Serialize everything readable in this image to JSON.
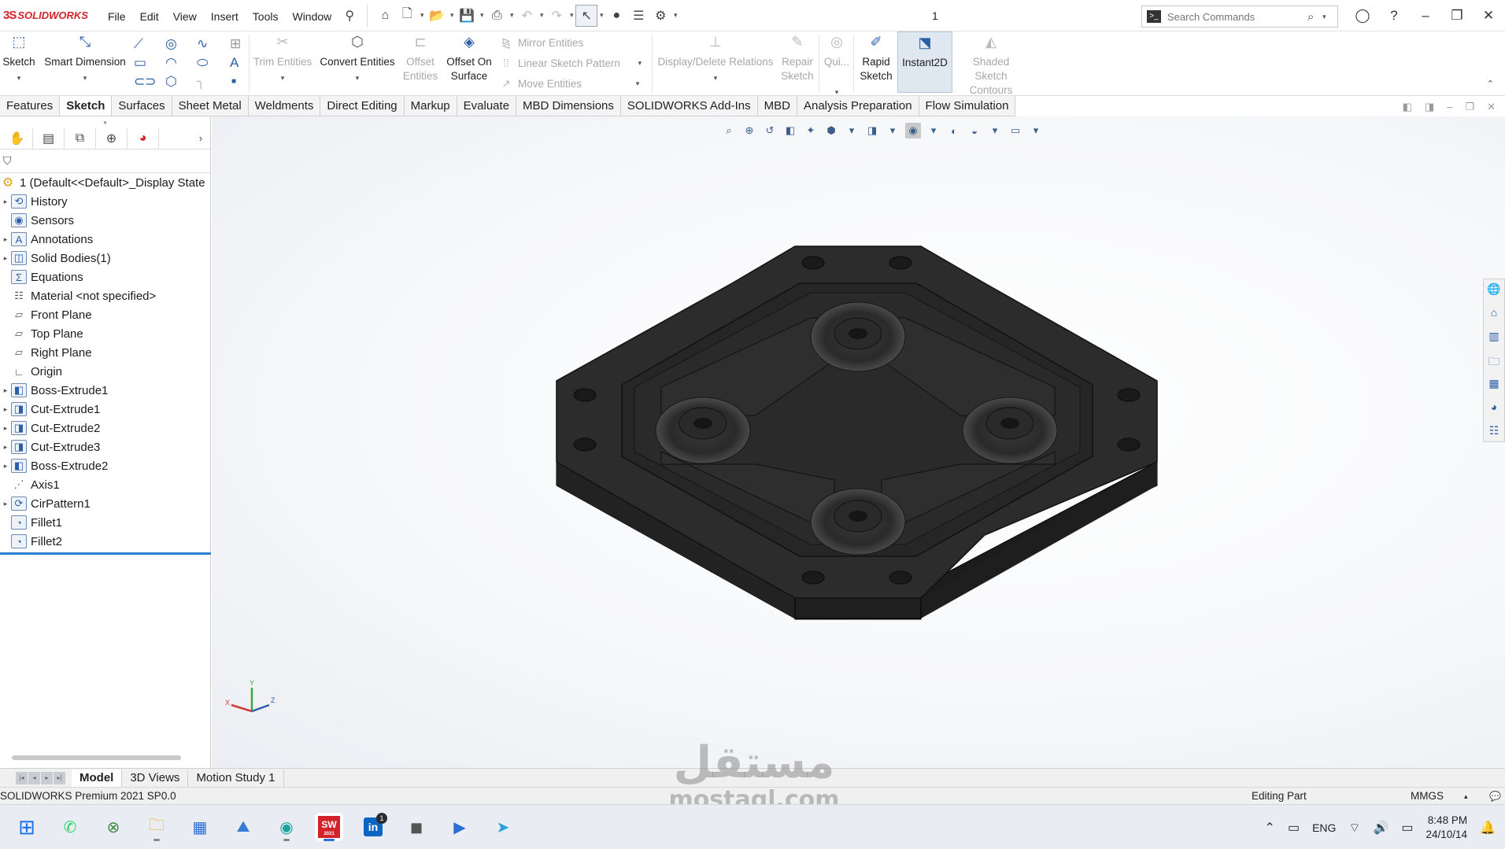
{
  "app": {
    "brand_ds": "3S",
    "brand_name": "SOLIDWORKS",
    "document_title": "1",
    "menu": [
      "File",
      "Edit",
      "View",
      "Insert",
      "Tools",
      "Window"
    ],
    "search_placeholder": "Search Commands"
  },
  "command_manager": {
    "sketch": "Sketch",
    "smart_dimension": "Smart Dimension",
    "trim_entities": "Trim Entities",
    "convert_entities": "Convert Entities",
    "offset_entities_1": "Offset",
    "offset_entities_2": "Entities",
    "offset_on_surface_1": "Offset On",
    "offset_on_surface_2": "Surface",
    "mirror_entities": "Mirror Entities",
    "linear_sketch_pattern": "Linear Sketch Pattern",
    "move_entities": "Move Entities",
    "display_delete_relations": "Display/Delete Relations",
    "repair_sketch_1": "Repair",
    "repair_sketch_2": "Sketch",
    "quick_snaps": "Qui...",
    "rapid_sketch_1": "Rapid",
    "rapid_sketch_2": "Sketch",
    "instant2d": "Instant2D",
    "shaded_sketch_1": "Shaded Sketch",
    "shaded_sketch_2": "Contours"
  },
  "tabs": [
    "Features",
    "Sketch",
    "Surfaces",
    "Sheet Metal",
    "Weldments",
    "Direct Editing",
    "Markup",
    "Evaluate",
    "MBD Dimensions",
    "SOLIDWORKS Add-Ins",
    "MBD",
    "Analysis Preparation",
    "Flow Simulation"
  ],
  "active_tab": "Sketch",
  "feature_tree": {
    "root": "1  (Default<<Default>_Display State",
    "items": [
      {
        "label": "History",
        "icon": "history-icon",
        "expandable": true
      },
      {
        "label": "Sensors",
        "icon": "sensors-icon",
        "expandable": false
      },
      {
        "label": "Annotations",
        "icon": "annotations-icon",
        "expandable": true
      },
      {
        "label": "Solid Bodies(1)",
        "icon": "solid-bodies-icon",
        "expandable": true
      },
      {
        "label": "Equations",
        "icon": "equations-icon",
        "expandable": false
      },
      {
        "label": "Material <not specified>",
        "icon": "material-icon",
        "expandable": false
      },
      {
        "label": "Front Plane",
        "icon": "plane-icon",
        "expandable": false
      },
      {
        "label": "Top Plane",
        "icon": "plane-icon",
        "expandable": false
      },
      {
        "label": "Right Plane",
        "icon": "plane-icon",
        "expandable": false
      },
      {
        "label": "Origin",
        "icon": "origin-icon",
        "expandable": false
      },
      {
        "label": "Boss-Extrude1",
        "icon": "extrude-icon",
        "expandable": true
      },
      {
        "label": "Cut-Extrude1",
        "icon": "cut-extrude-icon",
        "expandable": true
      },
      {
        "label": "Cut-Extrude2",
        "icon": "cut-extrude-icon",
        "expandable": true
      },
      {
        "label": "Cut-Extrude3",
        "icon": "cut-extrude-icon",
        "expandable": true
      },
      {
        "label": "Boss-Extrude2",
        "icon": "extrude-icon",
        "expandable": true
      },
      {
        "label": "Axis1",
        "icon": "axis-icon",
        "expandable": false
      },
      {
        "label": "CirPattern1",
        "icon": "circular-pattern-icon",
        "expandable": true
      },
      {
        "label": "Fillet1",
        "icon": "fillet-icon",
        "expandable": false
      },
      {
        "label": "Fillet2",
        "icon": "fillet-icon",
        "expandable": false
      }
    ]
  },
  "triad": {
    "x": "X",
    "y": "Y",
    "z": "Z"
  },
  "bottom_tabs": [
    "Model",
    "3D Views",
    "Motion Study 1"
  ],
  "status": {
    "product": "SOLIDWORKS Premium 2021 SP0.0",
    "mode": "Editing Part",
    "units": "MMGS"
  },
  "watermark": {
    "arabic": "مستقل",
    "latin": "mostaql.com"
  },
  "taskbar": {
    "apps": [
      "windows-start-icon",
      "whatsapp-icon",
      "xbox-icon",
      "file-explorer-icon",
      "microsoft-store-icon",
      "photos-icon",
      "edge-icon",
      "solidworks-icon",
      "linkedin-icon",
      "app-icon",
      "media-player-icon",
      "telegram-icon"
    ],
    "solidworks_label": "SW",
    "solidworks_year": "2021",
    "linkedin_label": "in",
    "linkedin_badge": "1",
    "language": "ENG",
    "time": "8:48 PM",
    "date": "24/10/14"
  },
  "colors": {
    "brand": "#d2232a",
    "accent": "#2b5ea7",
    "selection_line": "#2d7fd3",
    "model": "#2b2b2b"
  }
}
